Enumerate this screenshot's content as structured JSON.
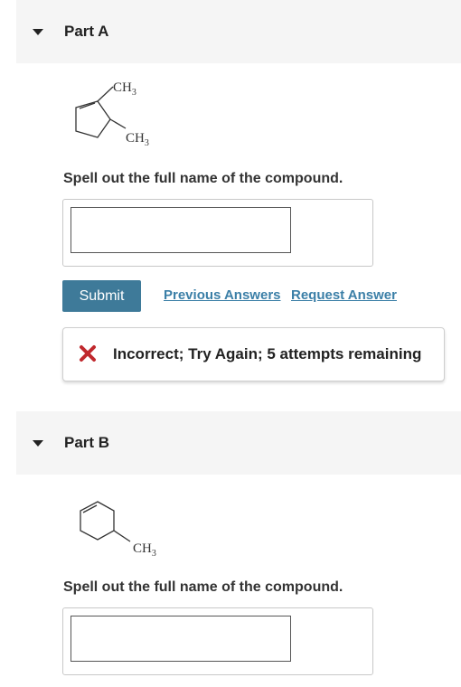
{
  "part_a": {
    "title": "Part A",
    "molecule": {
      "sub1": "CH",
      "sub1_n": "3",
      "sub2": "CH",
      "sub2_n": "3"
    },
    "prompt": "Spell out the full name of the compound.",
    "answer_value": "",
    "submit_label": "Submit",
    "previous_answers_label": "Previous Answers",
    "request_answer_label": "Request Answer",
    "feedback": "Incorrect; Try Again; 5 attempts remaining"
  },
  "part_b": {
    "title": "Part B",
    "molecule": {
      "sub1": "CH",
      "sub1_n": "3"
    },
    "prompt": "Spell out the full name of the compound.",
    "answer_value": ""
  },
  "colors": {
    "submit_bg": "#3e7a99",
    "link": "#3b7fa7",
    "error": "#c0282d",
    "header_bg": "#f5f5f5"
  },
  "icons": {
    "part_toggle": "caret-down-icon",
    "feedback": "x-mark-icon"
  }
}
